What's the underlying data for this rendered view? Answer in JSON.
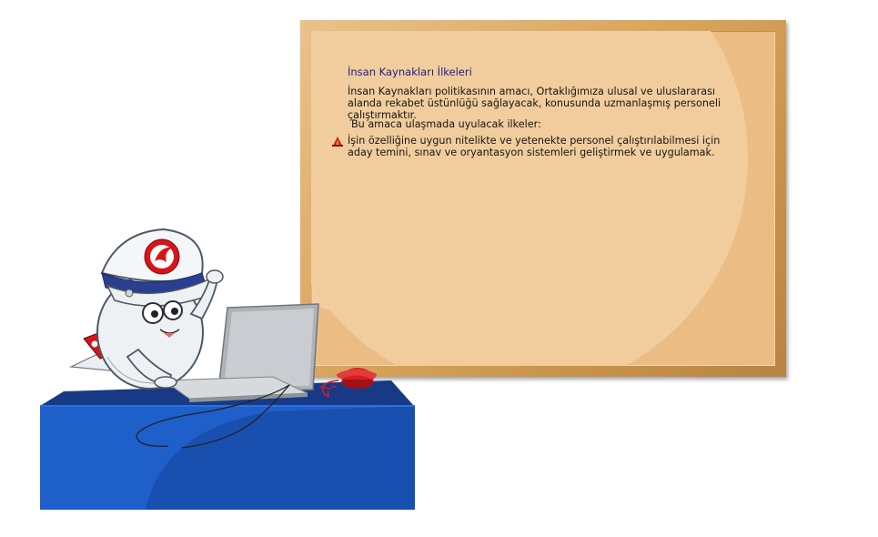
{
  "board": {
    "title": "İnsan Kaynakları İlkeleri",
    "intro": "İnsan Kaynakları politikasının amacı, Ortaklığımıza ulusal ve uluslararası alanda rekabet üstünlüğü sağlayacak, konusunda uzmanlaşmış personeli çalıştırmaktır.",
    "subhead": "Bu amaca ulaşmada uyulacak ilkeler:",
    "bullets": [
      "İşin özelliğine uygun nitelikte ve yetenekte personel çalıştırılabilmesi için aday temini, sınav ve oryantasyon sistemleri geliştirmek ve uygulamak."
    ]
  },
  "colors": {
    "title": "#1b1f8a",
    "desk": "#1f5fc9",
    "phone": "#d81e1e",
    "logo": "#d7141a"
  },
  "icons": {
    "bullet": "bell-bullet-icon",
    "logo": "airline-logo-icon"
  }
}
